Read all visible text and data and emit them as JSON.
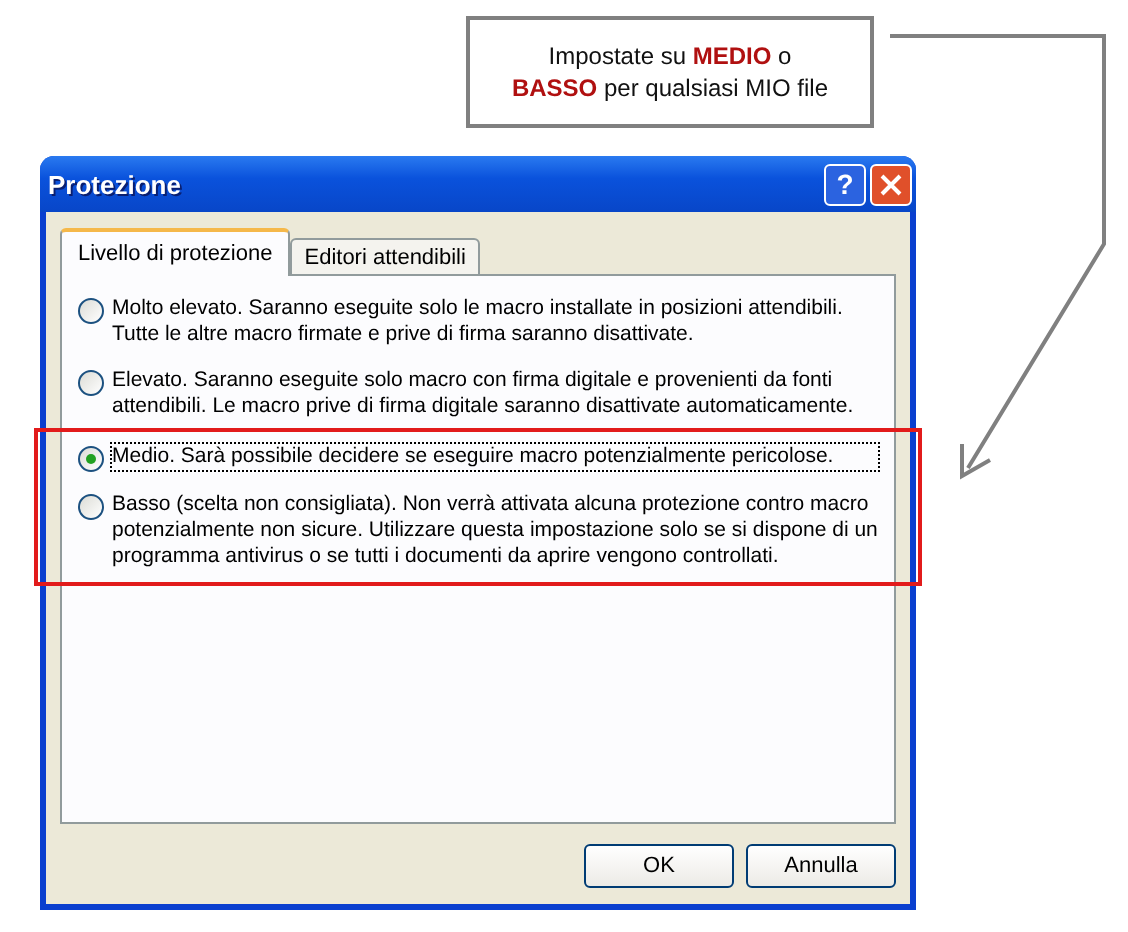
{
  "callout": {
    "lines": [
      "Impostate su **MEDIO** o",
      "**BASSO** per qualsiasi MIO file"
    ]
  },
  "window": {
    "title": "Protezione",
    "help": "?"
  },
  "tabs": [
    {
      "label": "Livello di protezione",
      "selected": true
    },
    {
      "label": "Editori attendibili",
      "selected": false
    }
  ],
  "options": [
    {
      "text": "Molto elevato. Saranno eseguite solo le macro installate in posizioni attendibili. Tutte le altre macro firmate e prive di firma saranno disattivate.",
      "selected": false,
      "highlighted": false
    },
    {
      "text": "Elevato. Saranno eseguite solo macro con firma digitale e provenienti da fonti attendibili. Le macro prive di firma digitale saranno disattivate automaticamente.",
      "selected": false,
      "highlighted": false
    },
    {
      "text": "Medio. Sarà possibile decidere se eseguire macro potenzialmente pericolose.",
      "selected": true,
      "highlighted": true
    },
    {
      "text": "Basso (scelta non consigliata). Non verrà attivata alcuna protezione contro macro potenzialmente non sicure. Utilizzare questa impostazione solo se si dispone di un programma antivirus o se tutti i documenti da aprire vengono controllati.",
      "selected": false,
      "highlighted": true
    }
  ],
  "buttons": [
    "OK",
    "Annulla"
  ]
}
